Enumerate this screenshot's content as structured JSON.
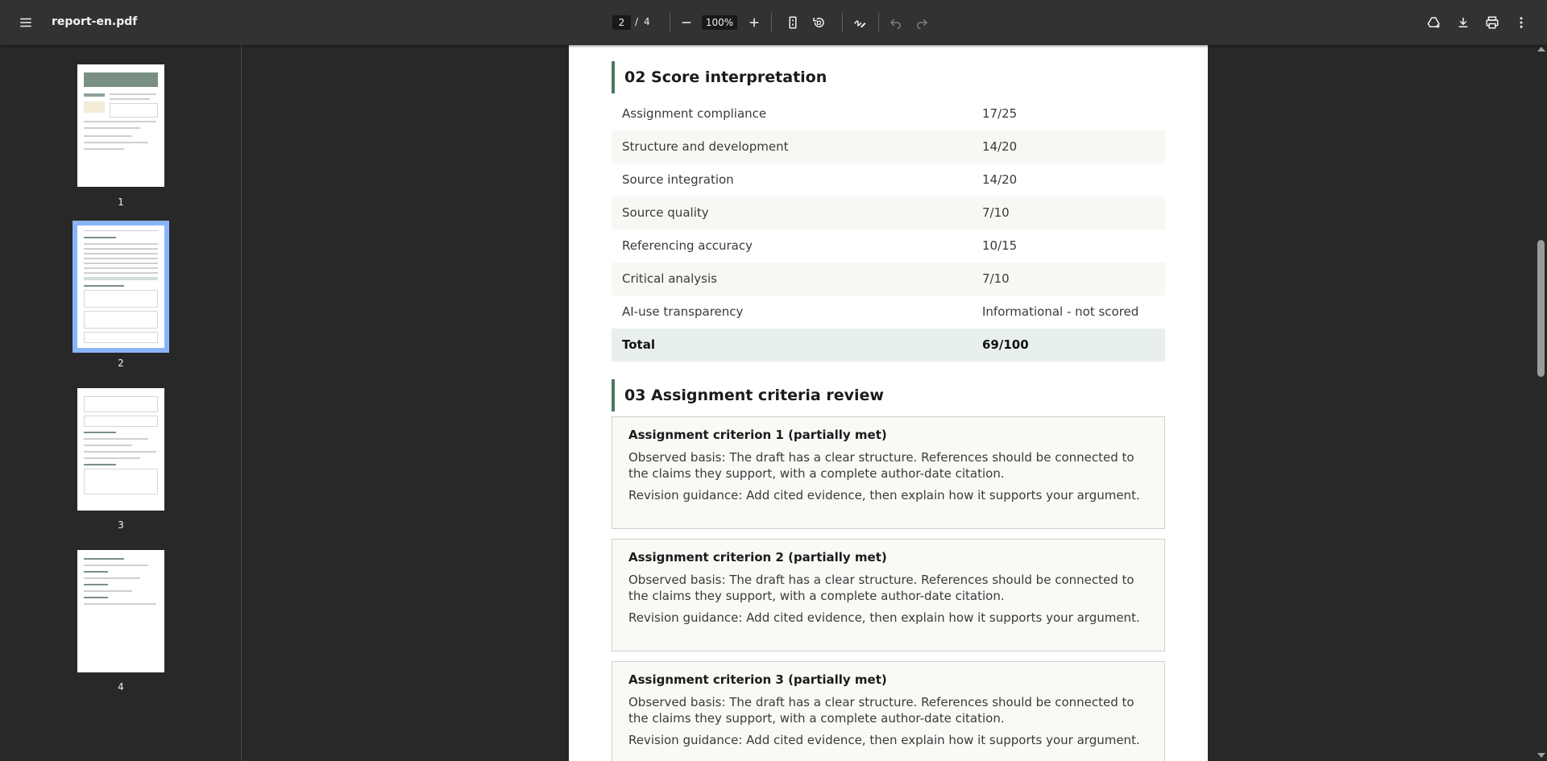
{
  "toolbar": {
    "title": "report-en.pdf",
    "page_current": "2",
    "page_separator": "/",
    "page_total": "4",
    "zoom": "100%",
    "icons": [
      "menu-icon",
      "zoom-out-icon",
      "zoom-in-icon",
      "fit-page-icon",
      "rotate-icon",
      "annotate-icon",
      "undo-icon",
      "redo-icon",
      "add-drive-icon",
      "download-icon",
      "print-icon",
      "more-icon"
    ]
  },
  "sidebar": {
    "thumbnails": [
      {
        "number": "1",
        "active": false
      },
      {
        "number": "2",
        "active": true
      },
      {
        "number": "3",
        "active": false
      },
      {
        "number": "4",
        "active": false
      }
    ]
  },
  "document": {
    "score_section": {
      "title": "02 Score interpretation",
      "rows": [
        {
          "label": "Assignment compliance",
          "value": "17/25"
        },
        {
          "label": "Structure and development",
          "value": "14/20"
        },
        {
          "label": "Source integration",
          "value": "14/20"
        },
        {
          "label": "Source quality",
          "value": "7/10"
        },
        {
          "label": "Referencing accuracy",
          "value": "10/15"
        },
        {
          "label": "Critical analysis",
          "value": "7/10"
        },
        {
          "label": "AI-use transparency",
          "value": "Informational - not scored"
        }
      ],
      "total": {
        "label": "Total",
        "value": "69/100"
      }
    },
    "criteria_section": {
      "title": "03 Assignment criteria review",
      "cards": [
        {
          "title": "Assignment criterion 1 (partially met)",
          "basis": "Observed basis: The draft has a clear structure. References should be connected to the claims they support, with a complete author-date citation.",
          "guidance": "Revision guidance: Add cited evidence, then explain how it supports your argument."
        },
        {
          "title": "Assignment criterion 2 (partially met)",
          "basis": "Observed basis: The draft has a clear structure. References should be connected to the claims they support, with a complete author-date citation.",
          "guidance": "Revision guidance: Add cited evidence, then explain how it supports your argument."
        },
        {
          "title": "Assignment criterion 3 (partially met)",
          "basis": "Observed basis: The draft has a clear structure. References should be connected to the claims they support, with a complete author-date citation.",
          "guidance": "Revision guidance: Add cited evidence, then explain how it supports your argument."
        }
      ]
    }
  },
  "colors": {
    "toolbar_bg": "#323232",
    "viewer_bg": "#282828",
    "accent_green": "#4b7a5e",
    "total_row_bg": "#e7f0ea",
    "active_thumb_outline": "#8ab4f8"
  }
}
